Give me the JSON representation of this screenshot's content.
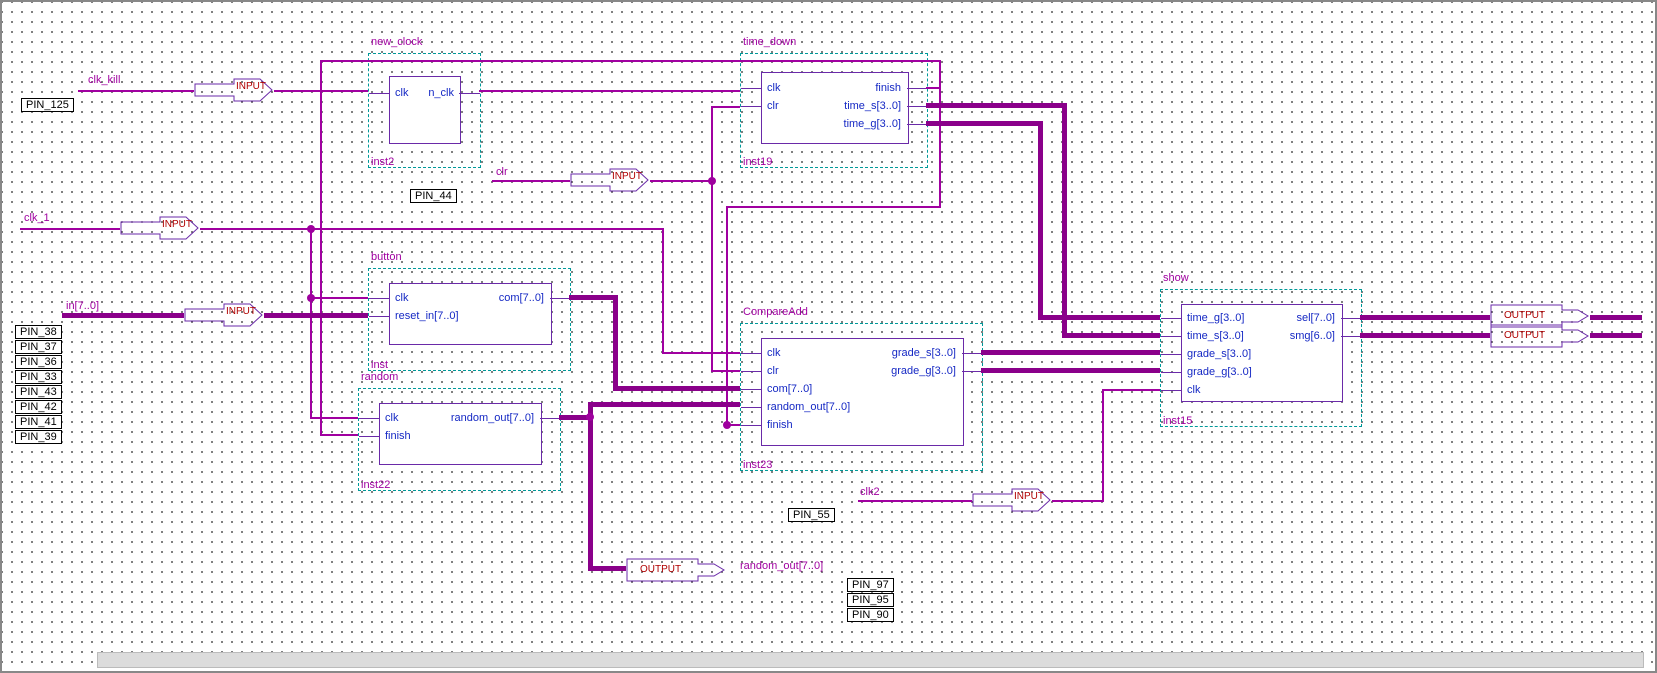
{
  "pins": {
    "clk_kill": "PIN_125",
    "clr": "PIN_44",
    "clk2": "PIN_55",
    "in_bus": [
      "PIN_38",
      "PIN_37",
      "PIN_36",
      "PIN_33",
      "PIN_43",
      "PIN_42",
      "PIN_41",
      "PIN_39"
    ],
    "random_out": [
      "PIN_97",
      "PIN_95",
      "PIN_90"
    ]
  },
  "nets": {
    "clk_kill": "clk_kill",
    "clr": "clr",
    "clk_1": "clk_1",
    "in": "in[7..0]",
    "clk2": "clk2",
    "random_out": "random_out[7..0]"
  },
  "io": {
    "input": "INPUT",
    "output": "OUTPUT"
  },
  "blocks": {
    "new_clock": {
      "title": "new_clock",
      "inst": "inst2",
      "ports": {
        "clk": "clk",
        "n_clk": "n_clk"
      }
    },
    "time_down": {
      "title": "time_down",
      "inst": "inst19",
      "ports": {
        "clk": "clk",
        "clr": "clr",
        "finish": "finish",
        "time_s": "time_s[3..0]",
        "time_g": "time_g[3..0]"
      }
    },
    "button": {
      "title": "button",
      "inst": "inst",
      "ports": {
        "clk": "clk",
        "reset_in": "reset_in[7..0]",
        "com": "com[7..0]"
      }
    },
    "random": {
      "title": "random",
      "inst": "inst22",
      "ports": {
        "clk": "clk",
        "finish": "finish",
        "random_out": "random_out[7..0]"
      }
    },
    "compare": {
      "title": "CompareAdd",
      "inst": "inst23",
      "ports": {
        "clk": "clk",
        "clr": "clr",
        "com": "com[7..0]",
        "random_out": "random_out[7..0]",
        "finish": "finish",
        "grade_s": "grade_s[3..0]",
        "grade_g": "grade_g[3..0]"
      }
    },
    "show": {
      "title": "show",
      "inst": "inst15",
      "ports": {
        "time_g": "time_g[3..0]",
        "time_s": "time_s[3..0]",
        "grade_s": "grade_s[3..0]",
        "grade_g": "grade_g[3..0]",
        "clk": "clk",
        "sel": "sel[7..0]",
        "smg": "smg[6..0]"
      }
    }
  }
}
